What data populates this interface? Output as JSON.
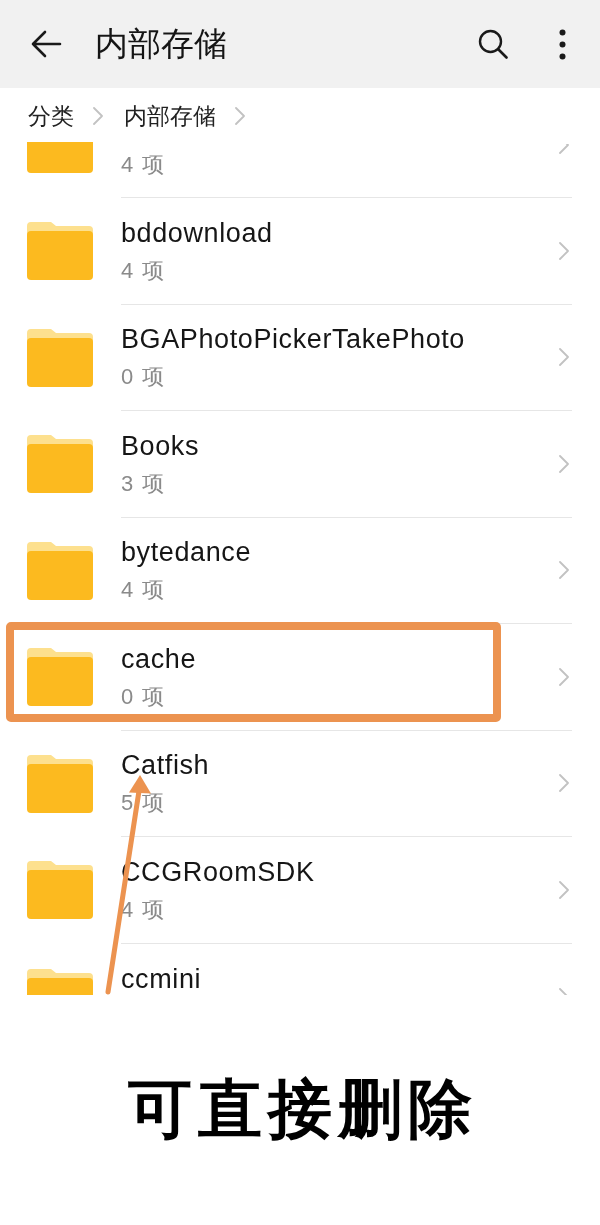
{
  "app_bar": {
    "title": "内部存储"
  },
  "breadcrumb": [
    {
      "label": "分类"
    },
    {
      "label": "内部存储"
    }
  ],
  "folders": [
    {
      "kind": "cut-top",
      "count": "4 项",
      "highlighted": false
    },
    {
      "kind": "full",
      "name": "bddownload",
      "count": "4 项",
      "highlighted": false
    },
    {
      "kind": "full",
      "name": "BGAPhotoPickerTakePhoto",
      "count": "0 项",
      "highlighted": false
    },
    {
      "kind": "full",
      "name": "Books",
      "count": "3 项",
      "highlighted": false
    },
    {
      "kind": "full",
      "name": "bytedance",
      "count": "4 项",
      "highlighted": false
    },
    {
      "kind": "full",
      "name": "cache",
      "count": "0 项",
      "highlighted": true
    },
    {
      "kind": "full",
      "name": "Catfish",
      "count": "5 项",
      "highlighted": false
    },
    {
      "kind": "full",
      "name": "CCGRoomSDK",
      "count": "4 项",
      "highlighted": false
    },
    {
      "kind": "cut-bottom",
      "name": "ccmini",
      "highlighted": false
    }
  ],
  "annotation": {
    "caption": "可直接删除"
  }
}
